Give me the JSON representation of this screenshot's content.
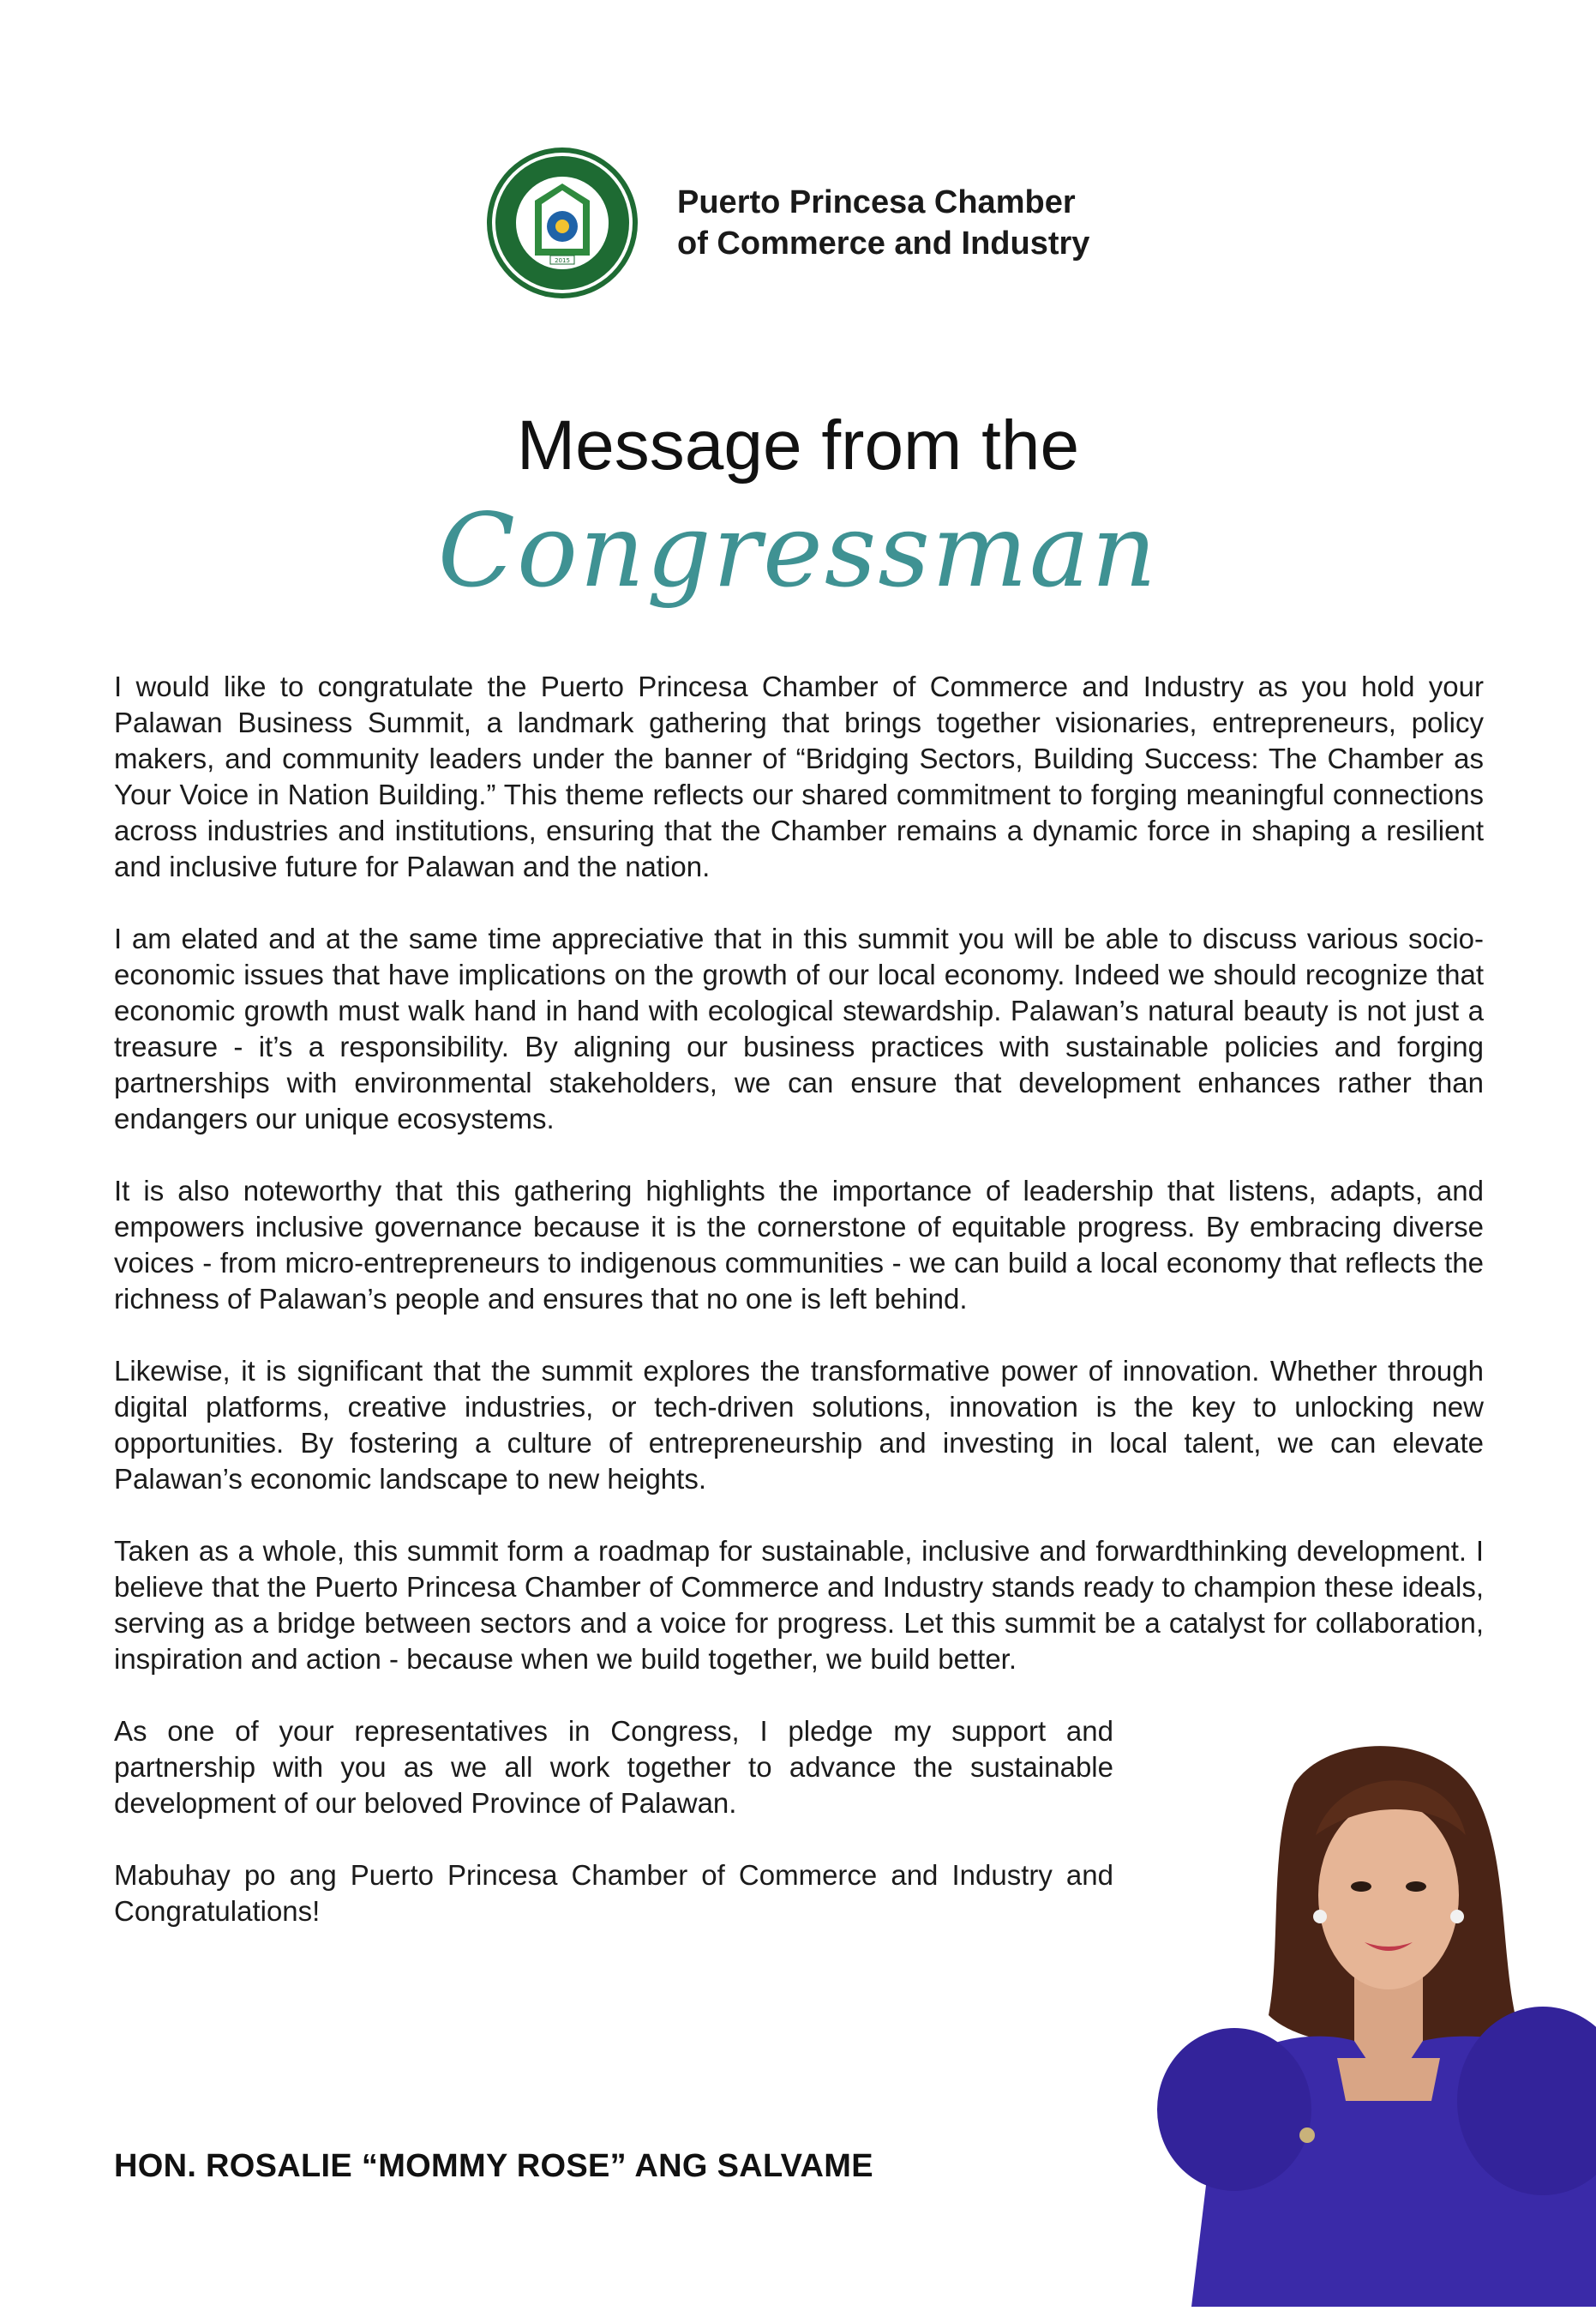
{
  "header": {
    "logo_seal_text": "PCCI PUERTO PRINCESA CHAMBER OF COMMERCE AND INDUSTRY INC.",
    "logo_year": "2015",
    "org_name_line1": "Puerto Princesa Chamber",
    "org_name_line2": "of Commerce and Industry"
  },
  "title": {
    "line1": "Message from the",
    "line2": "Congressman"
  },
  "paragraphs": [
    "I would like to congratulate the Puerto Princesa Chamber of Commerce and Industry as you hold your Palawan Business Summit, a landmark gathering that brings together visionaries, entrepreneurs, policy makers, and community leaders under the banner of “Bridging Sectors, Building Success: The Chamber as Your Voice in Nation Building.” This theme reflects our shared commitment to forging meaningful connections across industries and institutions, ensuring that the Chamber remains a dynamic force in shaping a resilient and inclusive future for Palawan and the nation.",
    "I am elated and at the same time appreciative that in this summit you will be able to discuss various socio-economic issues that have implications on the growth of our local economy. Indeed we should recognize that economic growth must walk hand in hand with ecological stewardship. Palawan’s natural beauty is not just a treasure - it’s a responsibility. By aligning our business practices with sustainable policies and forging partnerships with environmental stakeholders, we can ensure that development enhances rather than endangers our unique ecosystems.",
    "It is also noteworthy that this gathering highlights the importance of leadership that listens, adapts, and empowers inclusive governance because it is the cornerstone of equitable progress. By embracing diverse voices - from micro-entrepreneurs to indigenous communities - we can build a local economy that reflects the richness of Palawan’s people and ensures that no one is left behind.",
    "Likewise, it is significant that the summit explores the transformative power of innovation. Whether through digital platforms, creative industries, or tech-driven solutions, innovation is the key to unlocking new opportunities. By fostering a culture of entrepreneurship and investing in local talent, we can elevate Palawan’s economic landscape to new heights.",
    "Taken as a whole, this summit form a roadmap for sustainable, inclusive and forwardthinking development. I believe that the Puerto Princesa Chamber of Commerce and Industry stands ready to champion these ideals, serving as a bridge between sectors and a voice for progress. Let this summit be a catalyst for collaboration, inspiration and action - because when we build together, we build better.",
    "As one of your representatives in Congress, I pledge my support and partnership with you as we all work together to advance the sustainable development of our beloved Province of Palawan.",
    "Mabuhay po ang Puerto Princesa Chamber of Commerce and Industry and Congratulations!"
  ],
  "signature": "HON. ROSALIE “MOMMY ROSE” ANG SALVAME",
  "colors": {
    "accent_teal": "#3f9293",
    "logo_green": "#1e6b33",
    "dress_blue": "#3a2aa8"
  }
}
